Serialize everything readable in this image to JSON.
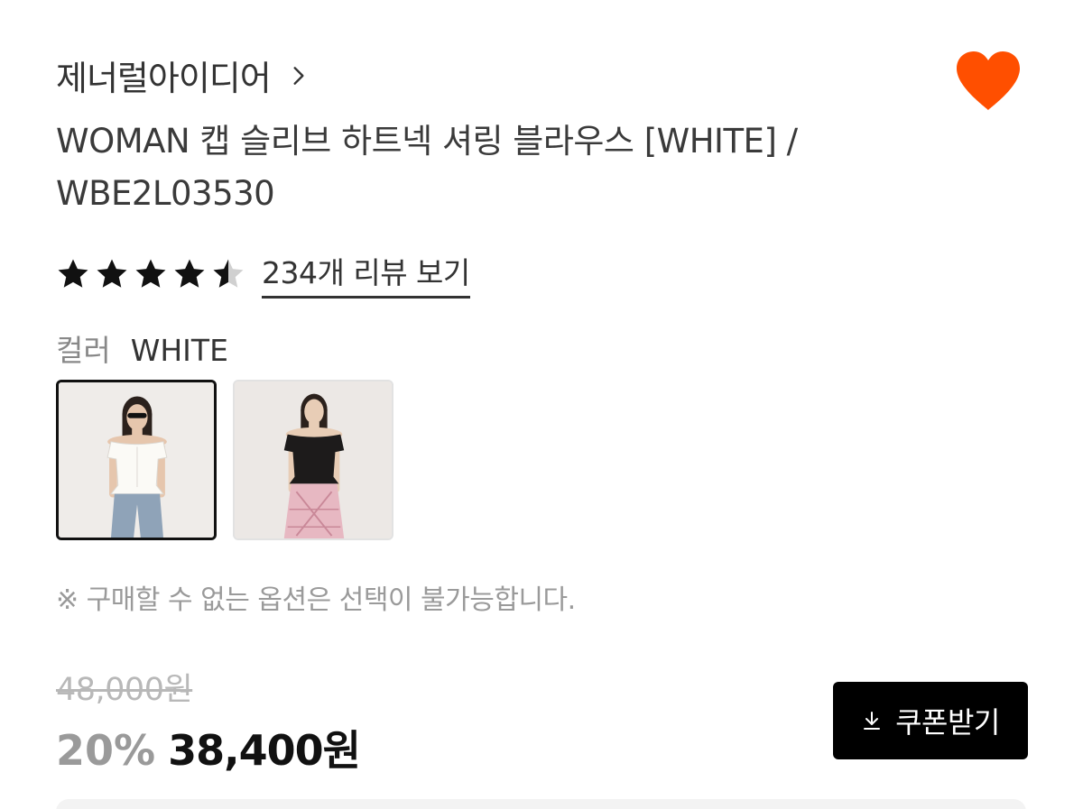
{
  "brand": {
    "name": "제너럴아이디어"
  },
  "product": {
    "title": "WOMAN 캡 슬리브 하트넥 셔링 블라우스 [WHITE] / WBE2L03530",
    "rating": 4.5,
    "review_link": "234개 리뷰 보기"
  },
  "color_option": {
    "label": "컬러",
    "value": "WHITE",
    "swatches": [
      {
        "name": "WHITE",
        "selected": true
      },
      {
        "name": "BLACK",
        "selected": false
      }
    ]
  },
  "notice": "※ 구매할 수 없는 옵션은 선택이 불가능합니다.",
  "price": {
    "original": "48,000원",
    "discount": "20%",
    "sale": "38,400원"
  },
  "coupon_button": {
    "label": "쿠폰받기",
    "icon": "download-icon"
  },
  "colors": {
    "heart": "#ff4f00",
    "star": "#111111",
    "star_empty": "#d0d0d0",
    "button_bg": "#000000"
  }
}
